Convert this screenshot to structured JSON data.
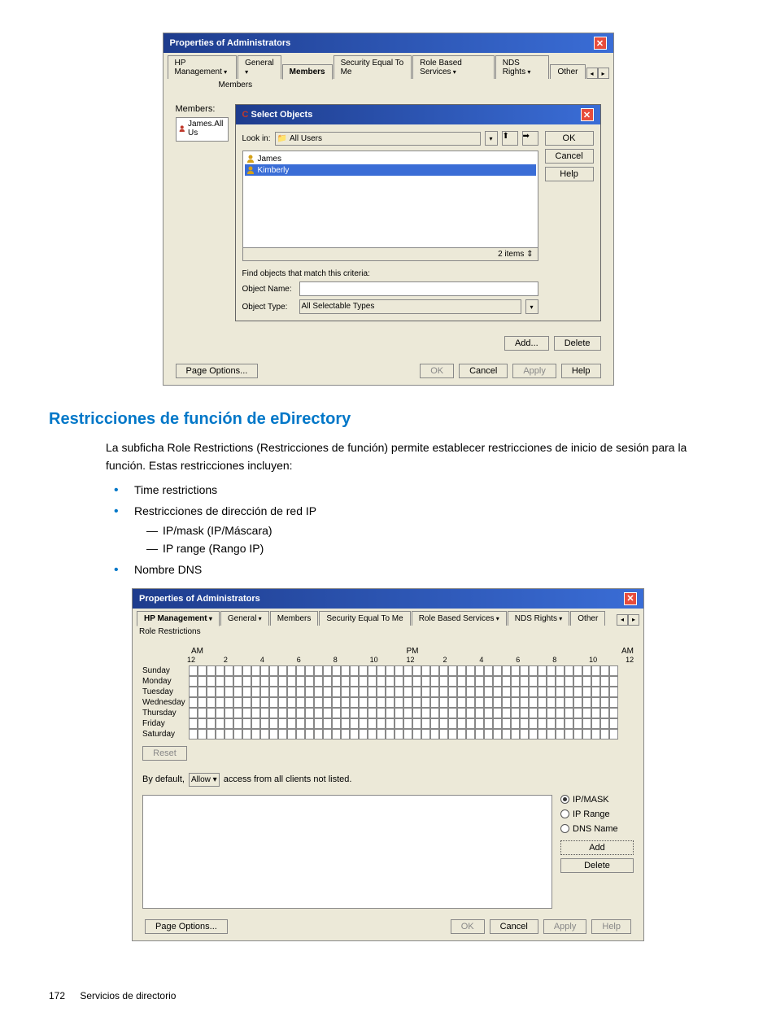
{
  "dialog1": {
    "title": "Properties of Administrators",
    "tabs": [
      "HP Management",
      "General",
      "Members",
      "Security Equal To Me",
      "Role Based Services",
      "NDS Rights",
      "Other"
    ],
    "active_tab": "Members",
    "sub_tab": "Members",
    "members_label": "Members:",
    "member_item": "James.All Us",
    "select_dialog": {
      "title": "Select Objects",
      "lookin_label": "Look in:",
      "lookin_value": "All Users",
      "items": [
        "James",
        "Kimberly"
      ],
      "item_count": "2 items",
      "criteria_label": "Find objects that match this criteria:",
      "obj_name_label": "Object Name:",
      "obj_type_label": "Object Type:",
      "obj_type_value": "All Selectable Types",
      "ok_btn": "OK",
      "cancel_btn": "Cancel",
      "help_btn": "Help"
    },
    "add_btn": "Add...",
    "delete_btn": "Delete",
    "page_options": "Page Options...",
    "ok": "OK",
    "cancel": "Cancel",
    "apply": "Apply",
    "help": "Help"
  },
  "section": {
    "heading": "Restricciones de función de eDirectory",
    "para": "La subficha Role Restrictions (Restricciones de función) permite establecer restricciones de inicio de sesión para la función. Estas restricciones incluyen:",
    "bullets": {
      "b1": "Time restrictions",
      "b2": "Restricciones de dirección de red IP",
      "b2a": "IP/mask (IP/Máscara)",
      "b2b": "IP range (Rango IP)",
      "b3": "Nombre DNS"
    }
  },
  "dialog2": {
    "title": "Properties of Administrators",
    "tabs": [
      "HP Management",
      "General",
      "Members",
      "Security Equal To Me",
      "Role Based Services",
      "NDS Rights",
      "Other"
    ],
    "active_tab": "HP Management",
    "sub_tab": "Role Restrictions",
    "am": "AM",
    "pm": "PM",
    "hours": [
      "12",
      "2",
      "4",
      "6",
      "8",
      "10",
      "12",
      "2",
      "4",
      "6",
      "8",
      "10",
      "12"
    ],
    "days": [
      "Sunday",
      "Monday",
      "Tuesday",
      "Wednesday",
      "Thursday",
      "Friday",
      "Saturday"
    ],
    "reset_btn": "Reset",
    "bydefault_label": "By default,",
    "bydefault_value": "Allow",
    "bydefault_suffix": "access from all clients not listed.",
    "radio1": "IP/MASK",
    "radio2": "IP Range",
    "radio3": "DNS Name",
    "add_btn": "Add",
    "delete_btn": "Delete",
    "page_options": "Page Options...",
    "ok": "OK",
    "cancel": "Cancel",
    "apply": "Apply",
    "help": "Help"
  },
  "footer": {
    "page": "172",
    "chapter": "Servicios de directorio"
  }
}
